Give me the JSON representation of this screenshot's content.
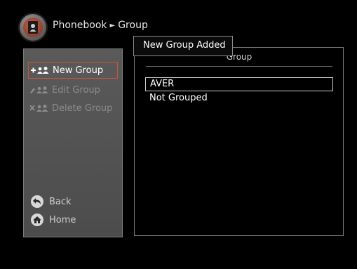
{
  "header": {
    "app_icon": "phonebook-icon",
    "breadcrumb": [
      "Phonebook",
      "Group"
    ],
    "separator": "►"
  },
  "sidebar": {
    "menu": [
      {
        "label": "New Group",
        "icon": "add-group-icon",
        "selected": true,
        "disabled": false
      },
      {
        "label": "Edit Group",
        "icon": "edit-group-icon",
        "selected": false,
        "disabled": true
      },
      {
        "label": "Delete Group",
        "icon": "delete-group-icon",
        "selected": false,
        "disabled": true
      }
    ],
    "nav": [
      {
        "label": "Back",
        "icon": "back-icon"
      },
      {
        "label": "Home",
        "icon": "home-icon"
      }
    ]
  },
  "main": {
    "column_header": "Group",
    "rows": [
      {
        "label": "AVER",
        "selected": true
      },
      {
        "label": "Not Grouped",
        "selected": false
      }
    ]
  },
  "toast": {
    "text": "New Group Added"
  },
  "colors": {
    "selection_border": "#c9563a",
    "panel": "#555555",
    "background": "#000000"
  }
}
